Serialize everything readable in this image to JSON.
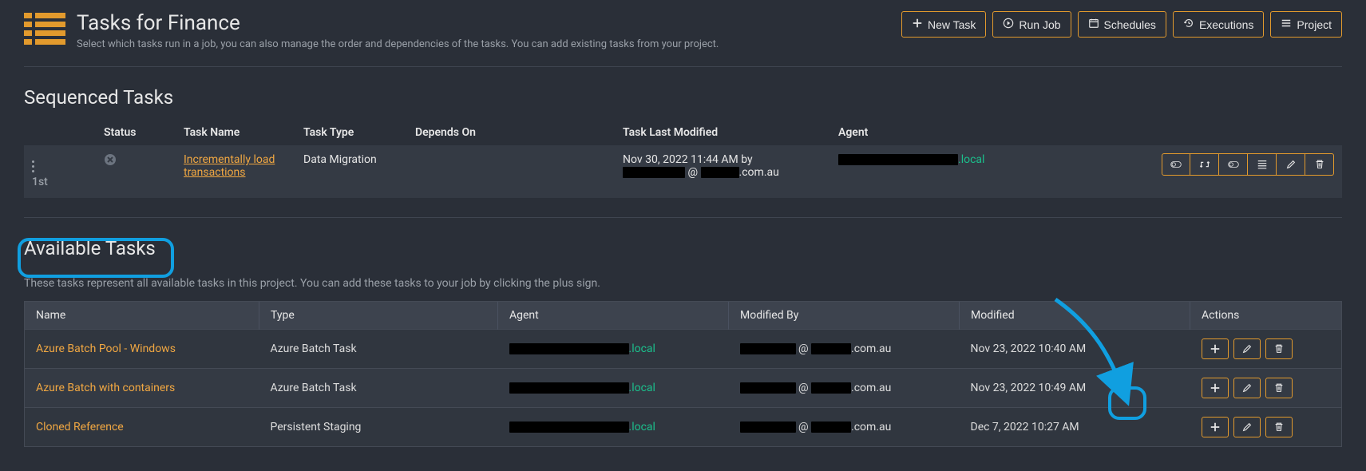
{
  "header": {
    "title": "Tasks for Finance",
    "subtitle": "Select which tasks run in a job, you can also manage the order and dependencies of the tasks. You can add existing tasks from your project."
  },
  "buttons": {
    "new_task": "New Task",
    "run_job": "Run Job",
    "schedules": "Schedules",
    "executions": "Executions",
    "project": "Project"
  },
  "sequenced": {
    "heading": "Sequenced Tasks",
    "columns": {
      "status": "Status",
      "task_name": "Task Name",
      "task_type": "Task Type",
      "depends_on": "Depends On",
      "last_modified": "Task Last Modified",
      "agent": "Agent"
    },
    "rows": [
      {
        "order": "1st",
        "task_name": "Incrementally load transactions",
        "task_type": "Data Migration",
        "depends_on": "",
        "last_modified": "Nov 30, 2022 11:44 AM by",
        "last_modified_by_suffix": ".com.au",
        "agent_suffix": ".local"
      }
    ]
  },
  "available": {
    "heading": "Available Tasks",
    "desc": "These tasks represent all available tasks in this project. You can add these tasks to your job by clicking the plus sign.",
    "columns": {
      "name": "Name",
      "type": "Type",
      "agent": "Agent",
      "modified_by": "Modified By",
      "modified": "Modified",
      "actions": "Actions"
    },
    "rows": [
      {
        "name": "Azure Batch Pool - Windows",
        "type": "Azure Batch Task",
        "agent_suffix": ".local",
        "modified_by_suffix": ".com.au",
        "modified": "Nov 23, 2022 10:40 AM"
      },
      {
        "name": "Azure Batch with containers",
        "type": "Azure Batch Task",
        "agent_suffix": ".local",
        "modified_by_suffix": ".com.au",
        "modified": "Nov 23, 2022 10:49 AM"
      },
      {
        "name": "Cloned Reference",
        "type": "Persistent Staging",
        "agent_suffix": ".local",
        "modified_by_suffix": ".com.au",
        "modified": "Dec 7, 2022 10:27 AM"
      }
    ]
  },
  "icons": {
    "plus": "+"
  }
}
